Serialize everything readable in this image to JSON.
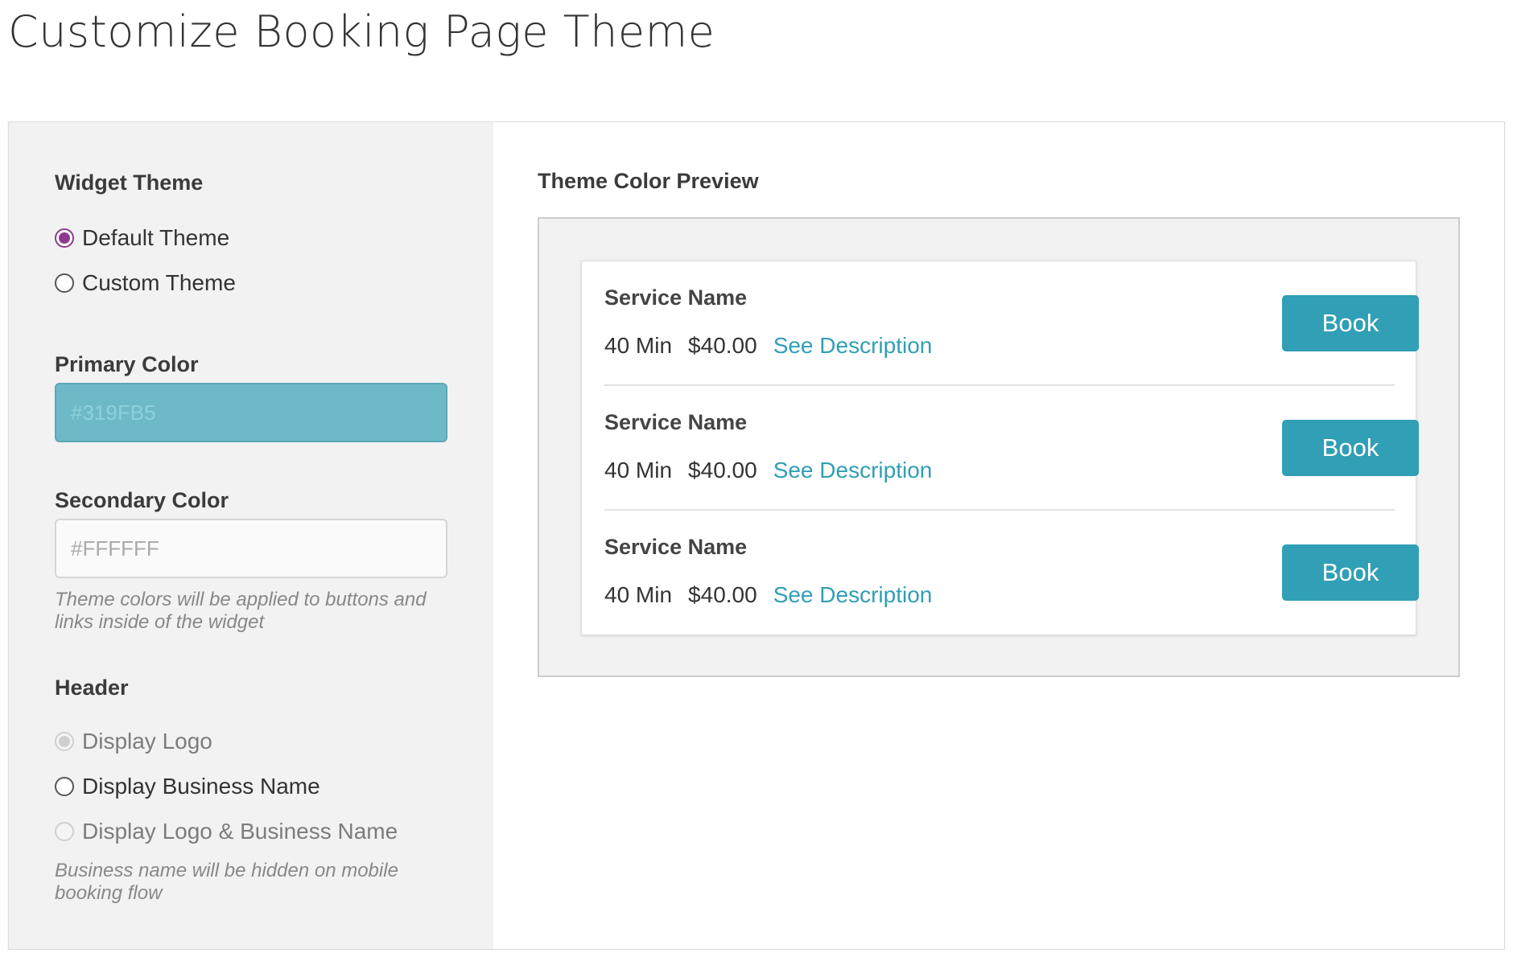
{
  "page": {
    "title": "Customize Booking Page Theme"
  },
  "settings": {
    "widget_theme": {
      "label": "Widget Theme",
      "options": [
        {
          "label": "Default Theme",
          "checked": true
        },
        {
          "label": "Custom Theme",
          "checked": false
        }
      ]
    },
    "primary_color": {
      "label": "Primary Color",
      "value": "#319FB5"
    },
    "secondary_color": {
      "label": "Secondary Color",
      "value": "#FFFFFF"
    },
    "color_hint": "Theme colors will be applied to buttons and links inside of the widget",
    "header": {
      "label": "Header",
      "options": [
        {
          "label": "Display Logo",
          "checked": true,
          "disabled": true
        },
        {
          "label": "Display Business Name",
          "checked": false,
          "disabled": false
        },
        {
          "label": "Display Logo & Business Name",
          "checked": false,
          "disabled": true
        }
      ],
      "hint": "Business name will be hidden on mobile booking flow"
    }
  },
  "preview": {
    "label": "Theme Color Preview",
    "services": [
      {
        "name": "Service Name",
        "duration": "40 Min",
        "price": "$40.00",
        "link": "See Description",
        "button": "Book"
      },
      {
        "name": "Service Name",
        "duration": "40 Min",
        "price": "$40.00",
        "link": "See Description",
        "button": "Book"
      },
      {
        "name": "Service Name",
        "duration": "40 Min",
        "price": "$40.00",
        "link": "See Description",
        "button": "Book"
      }
    ]
  },
  "colors": {
    "accent": "#319FB5",
    "radio_selected": "#8E3A8E",
    "panel_background": "#F2F2F2"
  }
}
